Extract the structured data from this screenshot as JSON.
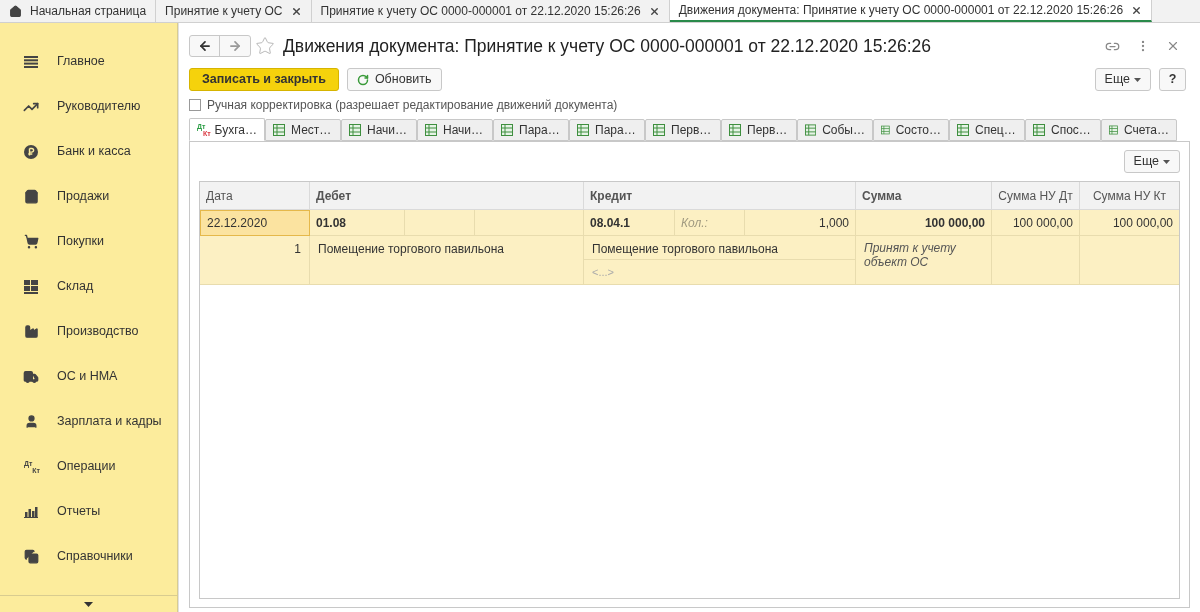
{
  "top_tabs": [
    {
      "label": "Начальная страница",
      "home": true,
      "closable": false,
      "selected": false
    },
    {
      "label": "Принятие к учету ОС",
      "home": false,
      "closable": true,
      "selected": false
    },
    {
      "label": "Принятие к учету ОС 0000-000001 от 22.12.2020 15:26:26",
      "home": false,
      "closable": true,
      "selected": false
    },
    {
      "label": "Движения документа: Принятие к учету ОС 0000-000001 от 22.12.2020 15:26:26",
      "home": false,
      "closable": true,
      "selected": true
    }
  ],
  "sidebar": {
    "items": [
      {
        "label": "Главное"
      },
      {
        "label": "Руководителю"
      },
      {
        "label": "Банк и касса"
      },
      {
        "label": "Продажи"
      },
      {
        "label": "Покупки"
      },
      {
        "label": "Склад"
      },
      {
        "label": "Производство"
      },
      {
        "label": "ОС и НМА"
      },
      {
        "label": "Зарплата и кадры"
      },
      {
        "label": "Операции",
        "icon_top": "Дт",
        "icon_bottom": "Кт"
      },
      {
        "label": "Отчеты"
      },
      {
        "label": "Справочники"
      }
    ]
  },
  "form": {
    "title": "Движения документа: Принятие к учету ОС 0000-000001 от 22.12.2020 15:26:26",
    "favorite": false,
    "primary_button": "Записать и закрыть",
    "refresh_button": "Обновить",
    "more_button": "Еще",
    "help_button": "?",
    "manual_edit": {
      "label": "Ручная корректировка (разрешает редактирование движений документа)",
      "checked": false
    },
    "sections": [
      {
        "label": "Бухга…",
        "kind": "accounting",
        "icon_top": "Дт",
        "icon_bottom": "Кт",
        "selected": true
      },
      {
        "label": "Мест…",
        "kind": "register",
        "selected": false
      },
      {
        "label": "Начи…",
        "kind": "register",
        "selected": false
      },
      {
        "label": "Начи…",
        "kind": "register",
        "selected": false
      },
      {
        "label": "Пара…",
        "kind": "register",
        "selected": false
      },
      {
        "label": "Пара…",
        "kind": "register",
        "selected": false
      },
      {
        "label": "Перв…",
        "kind": "register",
        "selected": false
      },
      {
        "label": "Перв…",
        "kind": "register",
        "selected": false
      },
      {
        "label": "Собы…",
        "kind": "register",
        "selected": false
      },
      {
        "label": "Состо…",
        "kind": "register",
        "selected": false
      },
      {
        "label": "Спец…",
        "kind": "register",
        "selected": false
      },
      {
        "label": "Спос…",
        "kind": "register",
        "selected": false
      },
      {
        "label": "Счета…",
        "kind": "register",
        "selected": false
      }
    ],
    "table_more_button": "Еще",
    "table": {
      "columns": [
        "Дата",
        "Дебет",
        "Кредит",
        "Сумма",
        "Сумма НУ Дт",
        "Сумма НУ Кт"
      ],
      "rows": [
        {
          "selected": true,
          "date": "22.12.2020",
          "line_number": "1",
          "debit_account": "01.08",
          "debit_subconto": "Помещение торгового павильона",
          "credit_account": "08.04.1",
          "quantity_label": "Кол.:",
          "quantity": "1,000",
          "credit_subconto": "Помещение торгового павильона",
          "credit_subconto_2": "<...>",
          "amount": "100 000,00",
          "content": "Принят к учету объект ОС",
          "amount_nu_dt": "100 000,00",
          "amount_nu_kt": "100 000,00"
        }
      ]
    }
  }
}
